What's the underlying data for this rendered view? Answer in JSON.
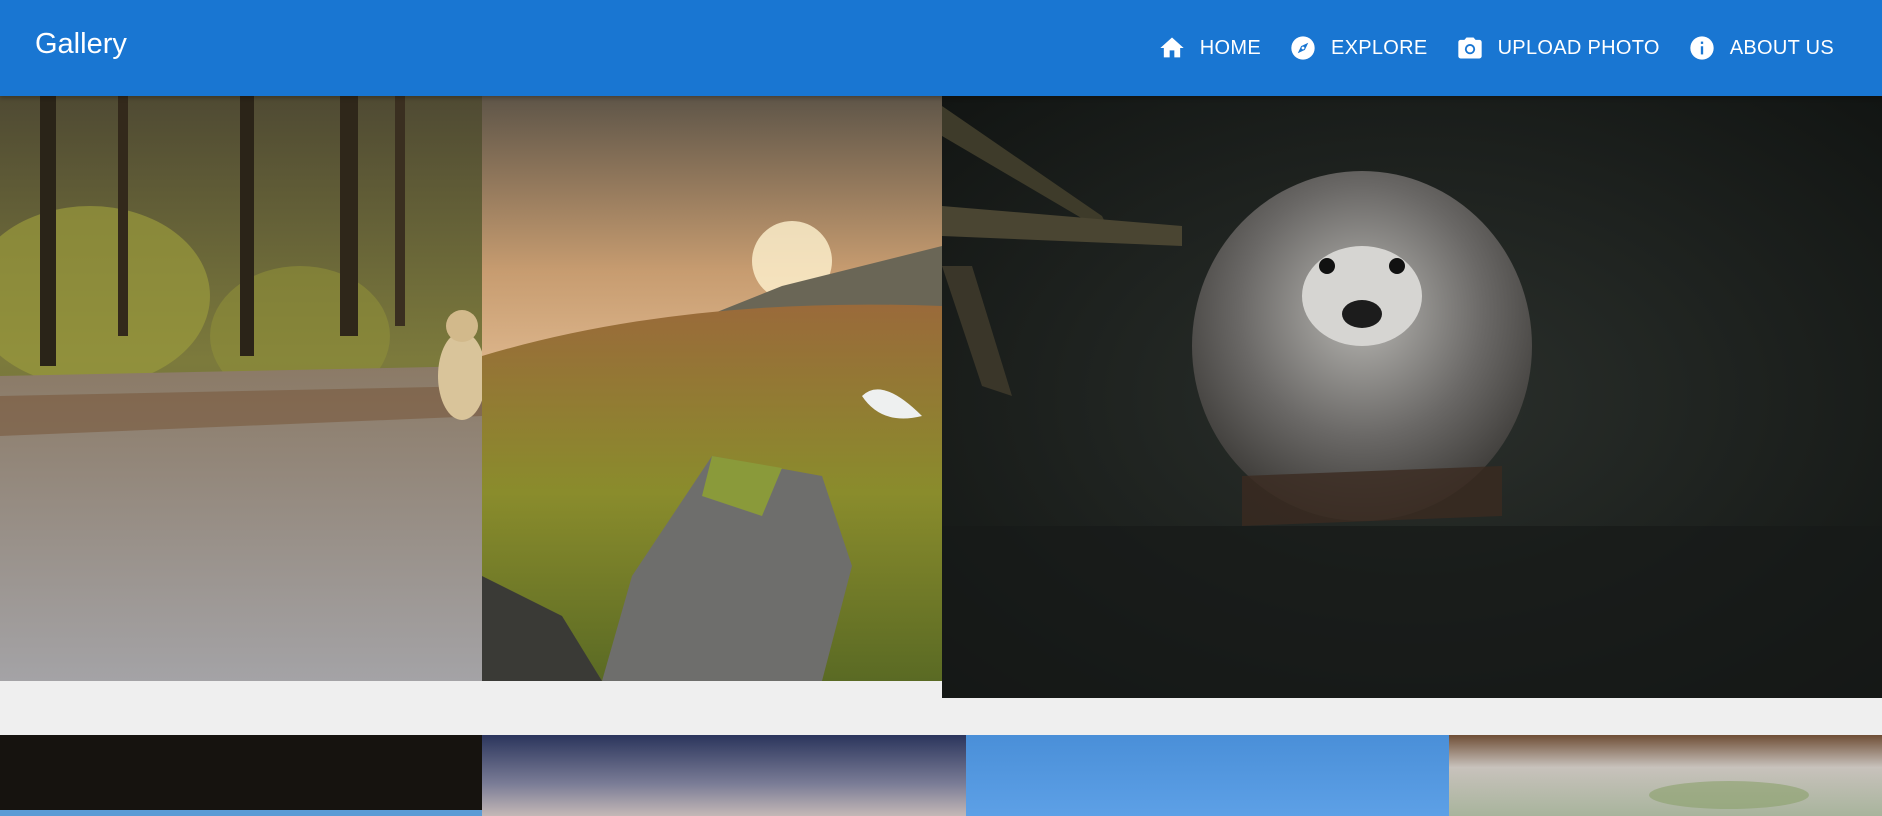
{
  "app": {
    "title": "Gallery"
  },
  "nav": {
    "items": [
      {
        "label": "HOME",
        "icon": "home-icon"
      },
      {
        "label": "EXPLORE",
        "icon": "compass-icon"
      },
      {
        "label": "UPLOAD PHOTO",
        "icon": "camera-icon"
      },
      {
        "label": "ABOUT US",
        "icon": "info-icon"
      }
    ]
  },
  "colors": {
    "appbar": "#1976d2",
    "page_background": "#efefef",
    "appbar_text": "#ffffff"
  },
  "gallery": {
    "photos": [
      {
        "subject": "autumn forest path with dog"
      },
      {
        "subject": "mountain valley sunset with rock"
      },
      {
        "subject": "nutria in dark water"
      },
      {
        "subject": "dark photo"
      },
      {
        "subject": "dusky blue sky"
      },
      {
        "subject": "blue sky"
      },
      {
        "subject": "blurred outdoor scene"
      }
    ]
  }
}
